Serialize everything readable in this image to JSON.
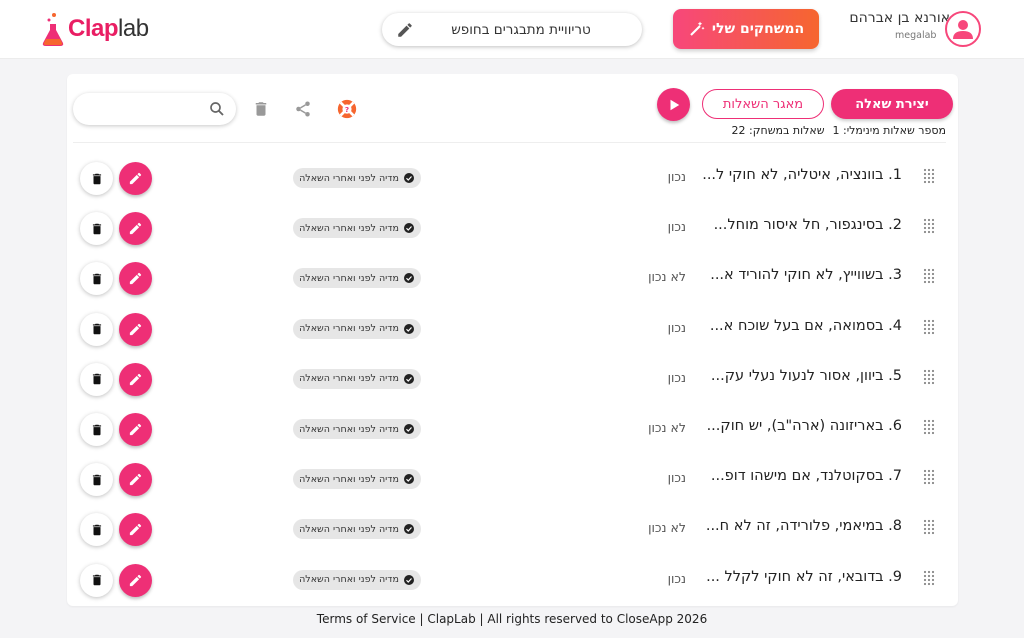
{
  "header": {
    "logo": {
      "clap": "Clap",
      "lab": "lab"
    },
    "game_title": "טריוויית מתבגרים בחופש",
    "my_games_label": "המשחקים שלי",
    "user": {
      "name": "אורנא בן אברהם",
      "org": "megalab"
    }
  },
  "toolbar": {
    "create_label": "יצירת שאלה",
    "repository_label": "מאגר השאלות",
    "search_placeholder": ""
  },
  "stats": {
    "min_questions": "מספר שאלות מינימלי: 1",
    "questions_in_game": "שאלות במשחק: 22"
  },
  "questions": [
    {
      "text": "1. בוונציה, איטליה, לא חוקי ל...",
      "answer": "נכון",
      "media": "מדיה לפני ואחרי השאלה"
    },
    {
      "text": "2. בסינגפור, חל איסור מוחל...",
      "answer": "נכון",
      "media": "מדיה לפני ואחרי השאלה"
    },
    {
      "text": "3. בשווייץ, לא חוקי להוריד א...",
      "answer": "לא נכון",
      "media": "מדיה לפני ואחרי השאלה"
    },
    {
      "text": "4. בסמואה, אם בעל שוכח א...",
      "answer": "נכון",
      "media": "מדיה לפני ואחרי השאלה"
    },
    {
      "text": "5. ביוון, אסור לנעול נעלי עק...",
      "answer": "נכון",
      "media": "מדיה לפני ואחרי השאלה"
    },
    {
      "text": "6. באריזונה (ארה\"ב), יש חוק...",
      "answer": "לא נכון",
      "media": "מדיה לפני ואחרי השאלה"
    },
    {
      "text": "7. בסקוטלנד, אם מישהו דופ...",
      "answer": "נכון",
      "media": "מדיה לפני ואחרי השאלה"
    },
    {
      "text": "8. במיאמי, פלורידה, זה לא ח...",
      "answer": "לא נכון",
      "media": "מדיה לפני ואחרי השאלה"
    },
    {
      "text": "9. בדובאי, זה לא חוקי לקלל ...",
      "answer": "נכון",
      "media": "מדיה לפני ואחרי השאלה"
    }
  ],
  "footer": "Terms of Service | ClapLab | All rights reserved to CloseApp 2026",
  "colors": {
    "accent": "#ee2f76",
    "gradient_start": "#f7477b",
    "gradient_end": "#f6662f"
  }
}
